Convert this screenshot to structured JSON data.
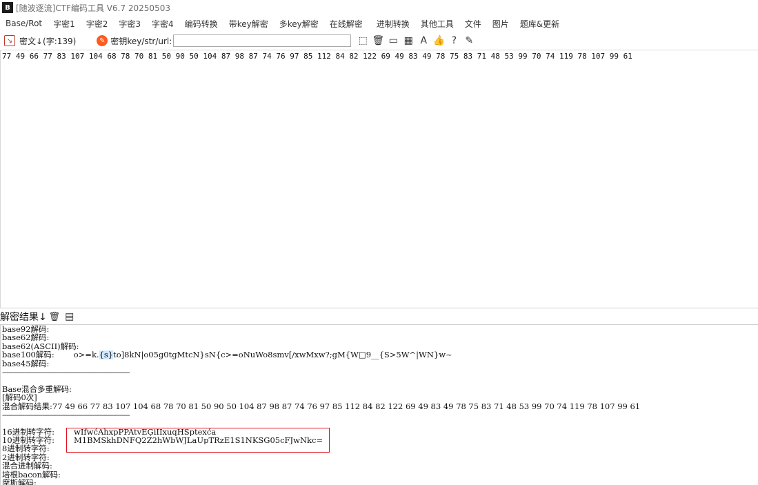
{
  "window": {
    "title": "[随波逐流]CTF编码工具 V6.7  20250503"
  },
  "menu": {
    "items": [
      "Base/Rot",
      "字密1",
      "字密2",
      "字密3",
      "字密4",
      "编码转换",
      "带key解密",
      "多key解密",
      "在线解密",
      "进制转换",
      "其他工具",
      "文件",
      "图片",
      "题库&更新"
    ]
  },
  "toolbar": {
    "cipher_label": "密文↓(字:139)",
    "key_label": "密钥key/str/url:",
    "key_value": ""
  },
  "cipher_text": "77 49 66 77 83 107 104 68 78 70 81 50 90 50 104 87 98 87 74 76 97 85 112 84 82 122 69 49 83 49 78 75 83 71 48 53 99 70 74 119 78 107 99 61",
  "result": {
    "header_label": "解密结果↓",
    "lines": {
      "base92": "base92解码:",
      "base62": "base62解码:",
      "base62ascii": "base62(ASCII)解码:",
      "base100_label": "base100解码:",
      "base100_pre": "o>=k.",
      "base100_hl": "{s}",
      "base100_post": "to]8kN|o05g0tgMtcN}sN{c>=oNuWo8smv[/xwMxw?;gM{W□9__{S>5W^|WN}w~",
      "base45": "base45解码:",
      "sep1": "----------------------------------------------------------------",
      "blank": "",
      "mixed": "Base混合多重解码:",
      "count": "[解码0次]",
      "mixed_result_label": "混合解码结果:",
      "mixed_result_value": "77 49 66 77 83 107 104 68 78 70 81 50 90 50 104 87 98 87 74 76 97 85 112 84 82 122 69 49 83 49 78 75 83 71 48 53 99 70 74 119 78 107 99 61",
      "sep2": "----------------------------------------------------------------",
      "hex_label": "16进制转字符:",
      "hex_value": "wIfwćAhxpPPAtvĒĢiIIxuqHSptexća",
      "dec_label": "10进制转字符:",
      "dec_value": "M1BMSkhDNFQ2Z2hWbWJLaUpTRzE1S1NKSG05cFJwNkc=",
      "oct": "8进制转字符:",
      "bin": "2进制转字符:",
      "mixbase": "混合进制解码:",
      "bacon": "培根bacon解码:",
      "morse": "摩斯解码:"
    }
  }
}
